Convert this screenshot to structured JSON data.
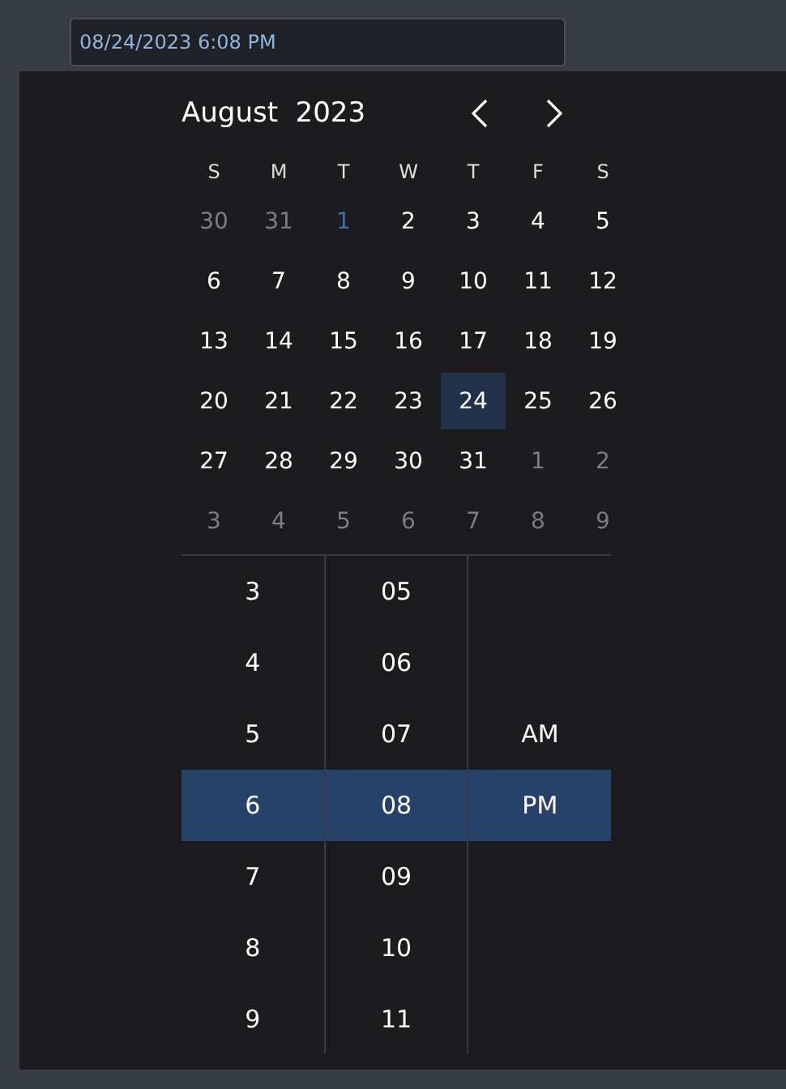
{
  "date_field": {
    "value": "08/24/2023 6:08 PM"
  },
  "calendar": {
    "month": "August",
    "year": "2023",
    "weekdays": [
      "S",
      "M",
      "T",
      "W",
      "T",
      "F",
      "S"
    ],
    "days": [
      {
        "label": "30",
        "other_month": true,
        "today": false,
        "selected": false
      },
      {
        "label": "31",
        "other_month": true,
        "today": false,
        "selected": false
      },
      {
        "label": "1",
        "other_month": false,
        "today": true,
        "selected": false
      },
      {
        "label": "2",
        "other_month": false,
        "today": false,
        "selected": false
      },
      {
        "label": "3",
        "other_month": false,
        "today": false,
        "selected": false
      },
      {
        "label": "4",
        "other_month": false,
        "today": false,
        "selected": false
      },
      {
        "label": "5",
        "other_month": false,
        "today": false,
        "selected": false
      },
      {
        "label": "6",
        "other_month": false,
        "today": false,
        "selected": false
      },
      {
        "label": "7",
        "other_month": false,
        "today": false,
        "selected": false
      },
      {
        "label": "8",
        "other_month": false,
        "today": false,
        "selected": false
      },
      {
        "label": "9",
        "other_month": false,
        "today": false,
        "selected": false
      },
      {
        "label": "10",
        "other_month": false,
        "today": false,
        "selected": false
      },
      {
        "label": "11",
        "other_month": false,
        "today": false,
        "selected": false
      },
      {
        "label": "12",
        "other_month": false,
        "today": false,
        "selected": false
      },
      {
        "label": "13",
        "other_month": false,
        "today": false,
        "selected": false
      },
      {
        "label": "14",
        "other_month": false,
        "today": false,
        "selected": false
      },
      {
        "label": "15",
        "other_month": false,
        "today": false,
        "selected": false
      },
      {
        "label": "16",
        "other_month": false,
        "today": false,
        "selected": false
      },
      {
        "label": "17",
        "other_month": false,
        "today": false,
        "selected": false
      },
      {
        "label": "18",
        "other_month": false,
        "today": false,
        "selected": false
      },
      {
        "label": "19",
        "other_month": false,
        "today": false,
        "selected": false
      },
      {
        "label": "20",
        "other_month": false,
        "today": false,
        "selected": false
      },
      {
        "label": "21",
        "other_month": false,
        "today": false,
        "selected": false
      },
      {
        "label": "22",
        "other_month": false,
        "today": false,
        "selected": false
      },
      {
        "label": "23",
        "other_month": false,
        "today": false,
        "selected": false
      },
      {
        "label": "24",
        "other_month": false,
        "today": false,
        "selected": true
      },
      {
        "label": "25",
        "other_month": false,
        "today": false,
        "selected": false
      },
      {
        "label": "26",
        "other_month": false,
        "today": false,
        "selected": false
      },
      {
        "label": "27",
        "other_month": false,
        "today": false,
        "selected": false
      },
      {
        "label": "28",
        "other_month": false,
        "today": false,
        "selected": false
      },
      {
        "label": "29",
        "other_month": false,
        "today": false,
        "selected": false
      },
      {
        "label": "30",
        "other_month": false,
        "today": false,
        "selected": false
      },
      {
        "label": "31",
        "other_month": false,
        "today": false,
        "selected": false
      },
      {
        "label": "1",
        "other_month": true,
        "today": false,
        "selected": false
      },
      {
        "label": "2",
        "other_month": true,
        "today": false,
        "selected": false
      },
      {
        "label": "3",
        "other_month": true,
        "today": false,
        "selected": false
      },
      {
        "label": "4",
        "other_month": true,
        "today": false,
        "selected": false
      },
      {
        "label": "5",
        "other_month": true,
        "today": false,
        "selected": false
      },
      {
        "label": "6",
        "other_month": true,
        "today": false,
        "selected": false
      },
      {
        "label": "7",
        "other_month": true,
        "today": false,
        "selected": false
      },
      {
        "label": "8",
        "other_month": true,
        "today": false,
        "selected": false
      },
      {
        "label": "9",
        "other_month": true,
        "today": false,
        "selected": false
      }
    ]
  },
  "time_picker": {
    "hours": [
      {
        "label": "3",
        "selected": false
      },
      {
        "label": "4",
        "selected": false
      },
      {
        "label": "5",
        "selected": false
      },
      {
        "label": "6",
        "selected": true
      },
      {
        "label": "7",
        "selected": false
      },
      {
        "label": "8",
        "selected": false
      },
      {
        "label": "9",
        "selected": false
      }
    ],
    "minutes": [
      {
        "label": "05",
        "selected": false
      },
      {
        "label": "06",
        "selected": false
      },
      {
        "label": "07",
        "selected": false
      },
      {
        "label": "08",
        "selected": true
      },
      {
        "label": "09",
        "selected": false
      },
      {
        "label": "10",
        "selected": false
      },
      {
        "label": "11",
        "selected": false
      }
    ],
    "periods": [
      {
        "label": "AM",
        "selected": false
      },
      {
        "label": "PM",
        "selected": true
      }
    ]
  }
}
